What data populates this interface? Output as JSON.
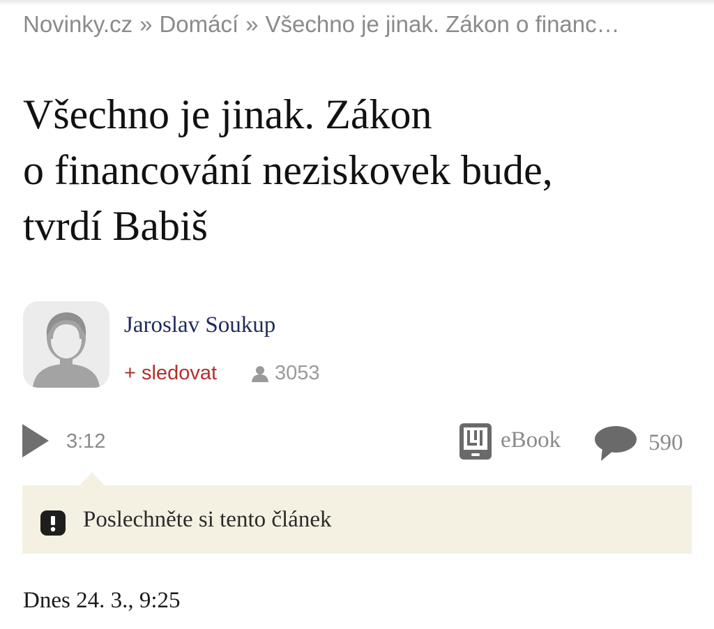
{
  "breadcrumb": {
    "site": "Novinky.cz",
    "separator": "»",
    "section": "Domácí",
    "current": "Všechno je jinak. Zákon o financ…"
  },
  "article": {
    "title_lines": [
      "Všechno je jinak. Zákon",
      "o financování neziskovek bude,",
      "tvrdí Babiš"
    ],
    "date": "Dnes 24. 3., 9:25"
  },
  "author": {
    "name": "Jaroslav Soukup",
    "follow_label": "+ sledovat",
    "followers": "3053",
    "avatar_icon": "person-silhouette-icon"
  },
  "toolbar": {
    "duration": "3:12",
    "ebook_label": "eBook",
    "comment_count": "590",
    "icons": [
      "play-icon",
      "ebook-icon",
      "comment-bubble-icon"
    ]
  },
  "listen_banner": {
    "text": "Poslechněte si tento článek",
    "icon": "info-icon",
    "background": "#f4f1e2"
  },
  "colors": {
    "accent_red": "#b2302b",
    "author_blue": "#1f2a5c",
    "muted_gray": "#8a8a8a"
  }
}
